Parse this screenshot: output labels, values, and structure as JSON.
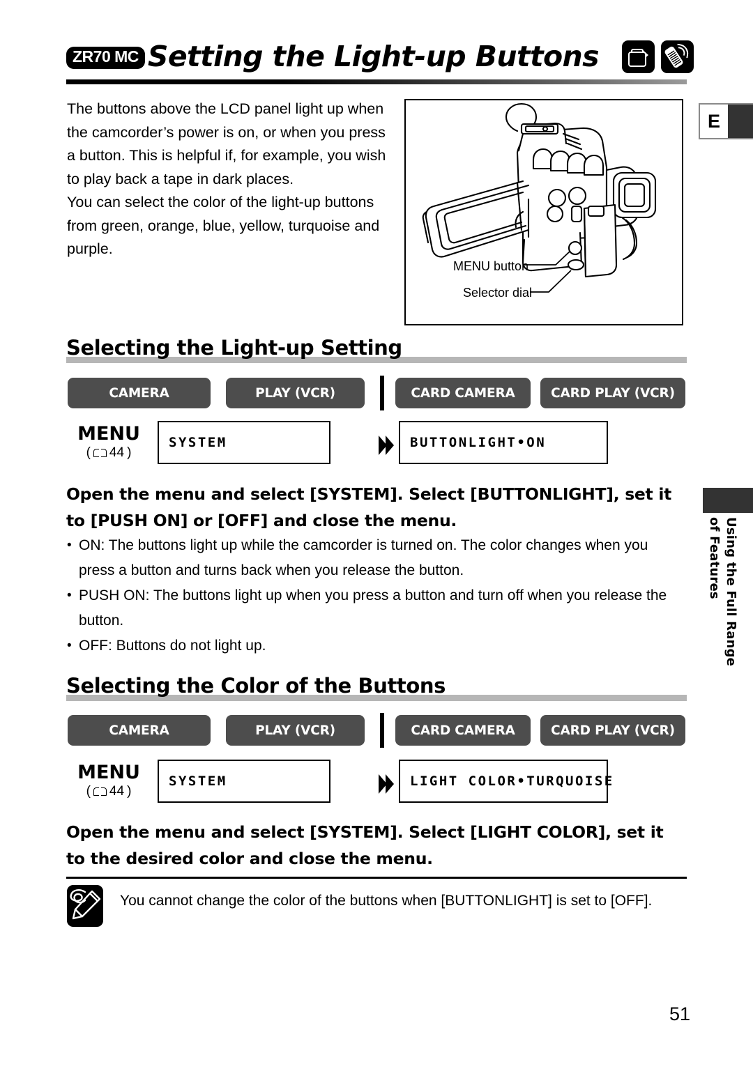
{
  "header": {
    "model_badge": "ZR70 MC",
    "title": "Setting the Light-up Buttons",
    "icons": [
      "camcorder-icon",
      "remote-control-icon"
    ],
    "language_tab": "E"
  },
  "intro": {
    "paragraph_1": "The buttons above the LCD panel light up when the camcorder’s power is on, or when you press a button. This is helpful if, for example, you wish to play back a tape in dark places.",
    "paragraph_2": "You can select the color of the light-up buttons from green, orange, blue, yellow, turquoise and purple."
  },
  "figure": {
    "label_menu_button": "MENU button",
    "label_selector_dial": "Selector dial"
  },
  "sections": [
    {
      "heading": "Selecting the Light-up Setting",
      "modes": [
        "CAMERA",
        "PLAY (VCR)",
        "CARD CAMERA",
        "CARD PLAY (VCR)"
      ],
      "menu": {
        "label": "MENU",
        "ref_page": "44",
        "box_1": "SYSTEM",
        "box_2": "BUTTONLIGHT•ON"
      },
      "instruction": "Open the menu and select [SYSTEM]. Select [BUTTONLIGHT], set it to [PUSH ON] or [OFF] and close the menu.",
      "bullets": [
        "ON: The buttons light up while the camcorder is turned on. The color changes when you press a button and turns back when you release the button.",
        "PUSH ON: The buttons light up when you press a button and turn off when you release the button.",
        "OFF: Buttons do not light up."
      ]
    },
    {
      "heading": "Selecting the Color of the Buttons",
      "modes": [
        "CAMERA",
        "PLAY (VCR)",
        "CARD CAMERA",
        "CARD PLAY (VCR)"
      ],
      "menu": {
        "label": "MENU",
        "ref_page": "44",
        "box_1": "SYSTEM",
        "box_2": "LIGHT COLOR•TURQUOISE"
      },
      "instruction": "Open the menu and select [SYSTEM]. Select [LIGHT COLOR], set it to the desired color and close the menu."
    }
  ],
  "note": {
    "icon": "pencil-note-icon",
    "text": "You cannot change the color of the buttons when [BUTTONLIGHT] is set to [OFF]."
  },
  "sidebar": {
    "line_1": "Using the Full Range",
    "line_2": "of Features"
  },
  "footer": {
    "page_number": "51"
  },
  "colors": {
    "mode_button_bg": "#4d4d4d",
    "heading_bar": "#b6b6b6",
    "tab_block": "#333333"
  }
}
